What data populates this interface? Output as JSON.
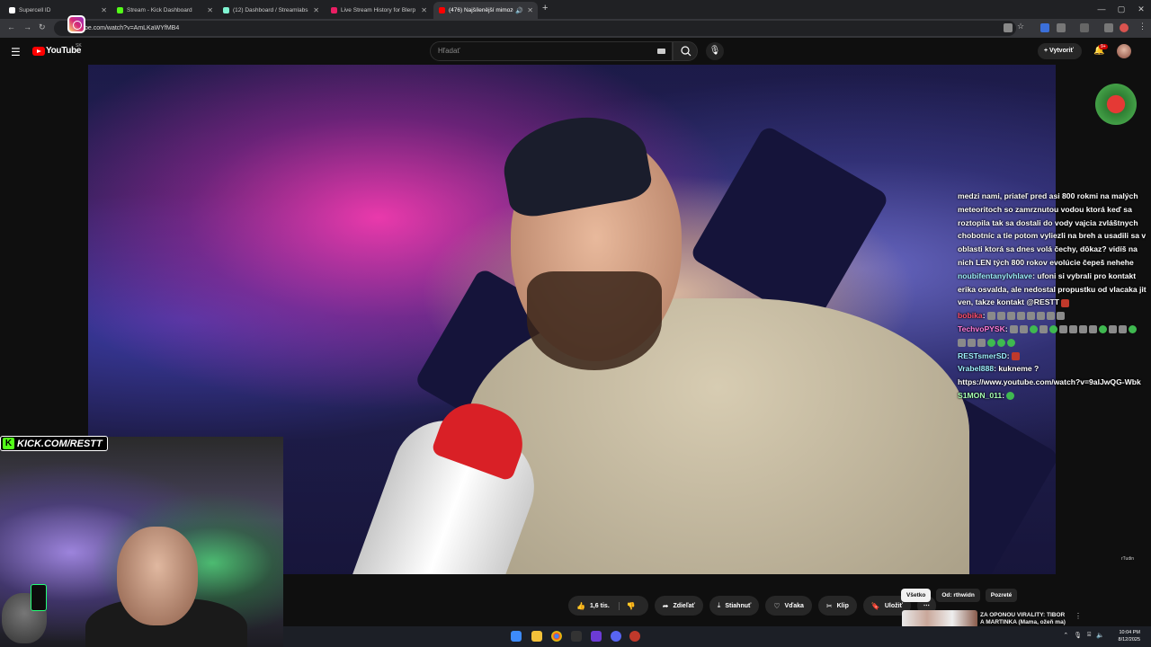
{
  "browser": {
    "tabs": [
      {
        "title": "Supercell ID",
        "color": "#ffffff"
      },
      {
        "title": "Stream - Kick Dashboard",
        "color": "#53fc18"
      },
      {
        "title": "(12) Dashboard / Streamlabs",
        "color": "#80f5d2"
      },
      {
        "title": "Live Stream History for Blerp S...",
        "color": "#e91e63"
      },
      {
        "title": "(476) Najšílenější mimozem...",
        "color": "#ff0000"
      }
    ],
    "new_tab": "+",
    "url": "be.com/watch?v=AmLKaWYfMB4"
  },
  "youtube": {
    "logo_text": "YouTube",
    "country_code": "SK",
    "search_placeholder": "Hľadať",
    "create_label": "Vytvoriť",
    "notification_count": "9+"
  },
  "video": {
    "watermark": "rTudin"
  },
  "chat": [
    {
      "user": "",
      "user_color": "",
      "text": "medzi nami, priateľ pred asi 800 rokmi na malých meteoritoch so zamrznutou vodou ktorá keď sa roztopila tak sa dostali do vody vajcia zvláštnych chobotníc a tie potom vyliezli na breh a usadili sa v oblasti ktorá sa dnes volá čechy, dôkaz? vidíš na nich LEN tých 800 rokov evolúcie čepeš nehehe",
      "emotes": []
    },
    {
      "user": "noubifentanylvhlave",
      "user_color": "#9ef0ff",
      "text": ": ufoni si vybrali pro kontakt erika osvalda, ale nedostal propustku od vlacaka jit ven, takze kontakt @RESTT",
      "emotes": [
        "r"
      ]
    },
    {
      "user": "bobika",
      "user_color": "#ff4d6d",
      "text": ":",
      "emotes": [
        "n",
        "n",
        "n",
        "n",
        "n",
        "n",
        "n",
        "n"
      ]
    },
    {
      "user": "TechvoPYSK",
      "user_color": "#ff7ad9",
      "text": ":",
      "emotes": [
        "n",
        "n",
        "g",
        "n",
        "g",
        "n",
        "n",
        "n",
        "n",
        "g",
        "n",
        "n",
        "g",
        "n",
        "n",
        "n",
        "g",
        "g",
        "g"
      ]
    },
    {
      "user": "RESTsmerSD",
      "user_color": "#9ef0ff",
      "text": ":",
      "emotes": [
        "r"
      ]
    },
    {
      "user": "Vrabel888",
      "user_color": "#9ef0ff",
      "text": ": kukneme ? https://www.youtube.com/watch?v=9aIJwQG-Wbk",
      "emotes": []
    },
    {
      "user": "S1MON_011",
      "user_color": "#a6ffb0",
      "text": ":",
      "emotes": [
        "g"
      ]
    }
  ],
  "stream_overlay": {
    "kick_text": "KICK.COM/RESTT"
  },
  "actions": {
    "likes": "1,6 tis.",
    "share": "Zdieľať",
    "download": "Stiahnuť",
    "thanks": "Vďaka",
    "clip": "Klip",
    "save": "Uložiť"
  },
  "related": {
    "chips": [
      "Všetko",
      "Od: rthwidn",
      "Pozreté"
    ],
    "first_title": "ZA OPONOU VIRALITY: TIBOR A MARTINKA (Mama, ožeň ma)"
  },
  "taskbar": {
    "time": "10:04 PM",
    "date": "8/12/2025"
  }
}
